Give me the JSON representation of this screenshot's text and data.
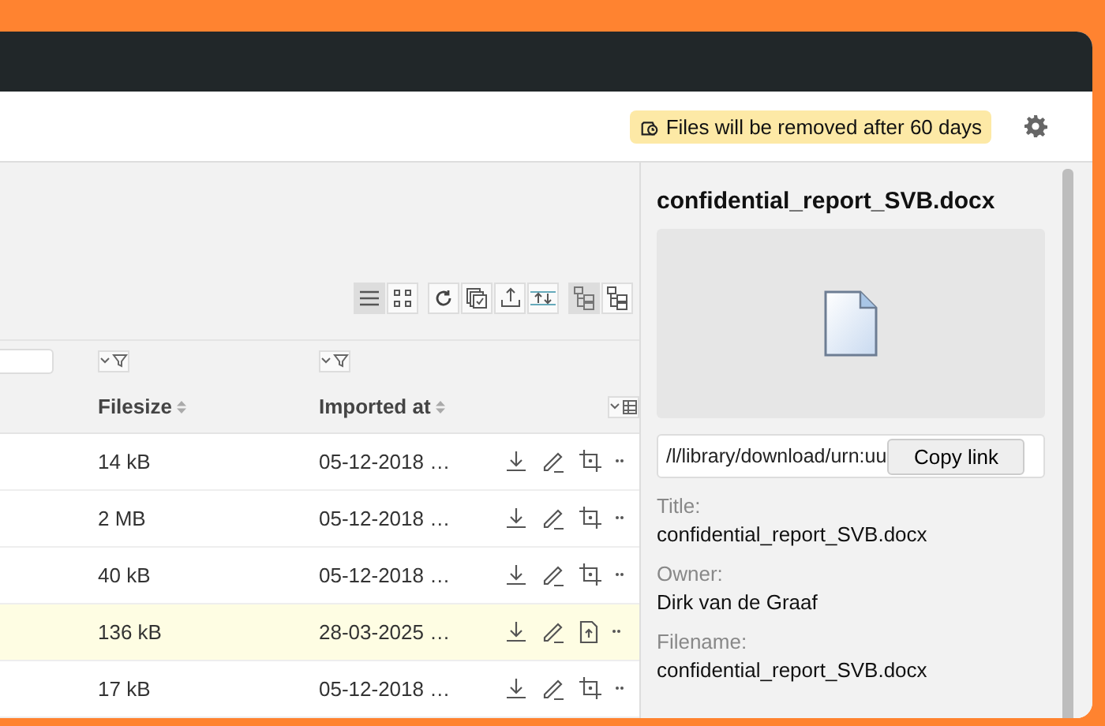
{
  "notice": {
    "text": "Files will be removed after 60 days"
  },
  "toolbar": {
    "view_buttons": [
      {
        "kind": "list",
        "selected": true
      },
      {
        "kind": "grid",
        "selected": false
      }
    ],
    "tree_buttons": [
      {
        "kind": "tree",
        "selected": true
      },
      {
        "kind": "tree-alt",
        "selected": false
      }
    ]
  },
  "table": {
    "columns": [
      {
        "label": "Filesize"
      },
      {
        "label": "Imported at"
      }
    ],
    "rows": [
      {
        "kind": "crop",
        "filesize": "14 kB",
        "imported": "05-12-2018 …",
        "selected": false
      },
      {
        "kind": "crop",
        "filesize": "2 MB",
        "imported": "05-12-2018 …",
        "selected": false
      },
      {
        "kind": "crop",
        "filesize": "40 kB",
        "imported": "05-12-2018 …",
        "selected": false
      },
      {
        "kind": "upload",
        "filesize": "136 kB",
        "imported": "28-03-2025 …",
        "selected": true
      },
      {
        "kind": "crop",
        "filesize": "17 kB",
        "imported": "05-12-2018 …",
        "selected": false
      }
    ]
  },
  "details": {
    "title": "confidential_report_SVB.docx",
    "link": {
      "value": "/l/library/download/urn:uu",
      "button": "Copy link"
    },
    "fields": [
      {
        "label": "Title:",
        "value": "confidential_report_SVB.docx"
      },
      {
        "label": "Owner:",
        "value": "Dirk van de Graaf"
      },
      {
        "label": "Filename:",
        "value": "confidential_report_SVB.docx"
      }
    ]
  }
}
